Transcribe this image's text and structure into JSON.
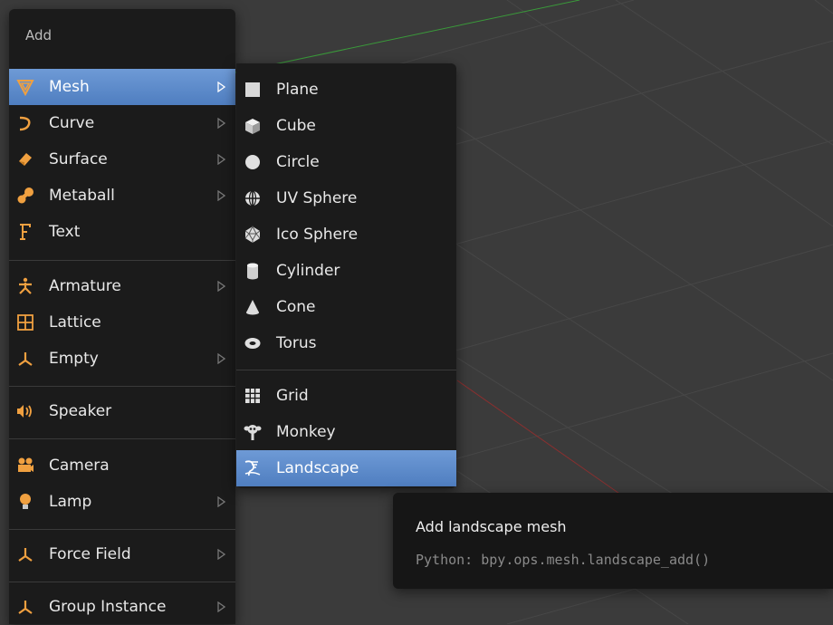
{
  "add_menu": {
    "title": "Add",
    "items": [
      {
        "label": "Mesh",
        "icon": "mesh-icon",
        "submenu": true,
        "highlighted": true
      },
      {
        "label": "Curve",
        "icon": "curve-icon",
        "submenu": true
      },
      {
        "label": "Surface",
        "icon": "surface-icon",
        "submenu": true
      },
      {
        "label": "Metaball",
        "icon": "metaball-icon",
        "submenu": true
      },
      {
        "label": "Text",
        "icon": "text-icon",
        "submenu": false
      },
      {
        "label": "Armature",
        "icon": "armature-icon",
        "submenu": true
      },
      {
        "label": "Lattice",
        "icon": "lattice-icon",
        "submenu": false
      },
      {
        "label": "Empty",
        "icon": "empty-icon",
        "submenu": true
      },
      {
        "label": "Speaker",
        "icon": "speaker-icon",
        "submenu": false
      },
      {
        "label": "Camera",
        "icon": "camera-icon",
        "submenu": false
      },
      {
        "label": "Lamp",
        "icon": "lamp-icon",
        "submenu": true
      },
      {
        "label": "Force Field",
        "icon": "force-field-icon",
        "submenu": true
      },
      {
        "label": "Group Instance",
        "icon": "group-instance-icon",
        "submenu": true
      }
    ]
  },
  "mesh_menu": {
    "items": [
      {
        "label": "Plane",
        "icon": "plane-icon"
      },
      {
        "label": "Cube",
        "icon": "cube-icon"
      },
      {
        "label": "Circle",
        "icon": "circle-icon"
      },
      {
        "label": "UV Sphere",
        "icon": "uv-sphere-icon"
      },
      {
        "label": "Ico Sphere",
        "icon": "ico-sphere-icon"
      },
      {
        "label": "Cylinder",
        "icon": "cylinder-icon"
      },
      {
        "label": "Cone",
        "icon": "cone-icon"
      },
      {
        "label": "Torus",
        "icon": "torus-icon"
      },
      {
        "label": "Grid",
        "icon": "grid-icon"
      },
      {
        "label": "Monkey",
        "icon": "monkey-icon"
      },
      {
        "label": "Landscape",
        "icon": "landscape-icon",
        "highlighted": true
      }
    ]
  },
  "tooltip": {
    "title": "Add landscape mesh",
    "python": "Python: bpy.ops.mesh.landscape_add()"
  },
  "colors": {
    "highlight": "#5a87c8",
    "menu_bg": "#1b1b1b",
    "viewport_bg": "#3b3b3b",
    "icon_orange": "#f0a040",
    "x_axis": "#a03030",
    "y_axis": "#3a9a3a"
  }
}
